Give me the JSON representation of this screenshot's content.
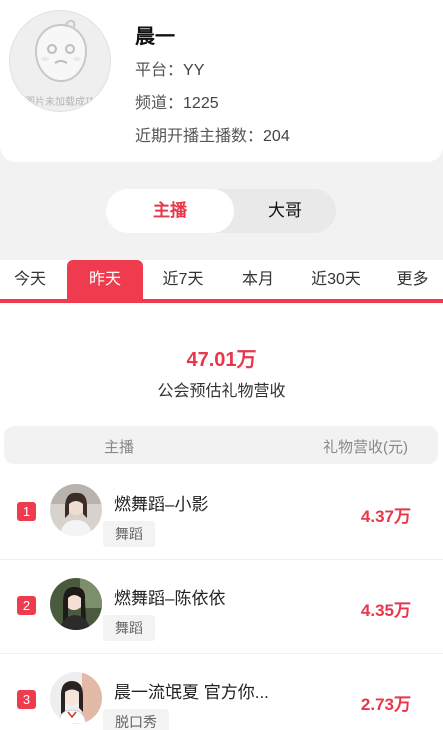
{
  "guild": {
    "avatar_fail_text": "图片未加载成功",
    "name": "晨一",
    "platform_label": "平台：",
    "platform_value": "YY",
    "channel_label": "频道：",
    "channel_value": "1225",
    "recent_label": "近期开播主播数：",
    "recent_value": "204"
  },
  "segment": {
    "options": [
      "主播",
      "大哥"
    ],
    "selected": "主播"
  },
  "tabs": {
    "items": [
      "今天",
      "昨天",
      "近7天",
      "本月",
      "近30天",
      "更多"
    ],
    "selected": "昨天"
  },
  "summary": {
    "total_value": "47.01万",
    "total_label": "公会预估礼物营收"
  },
  "table": {
    "headers": [
      "主播",
      "礼物营收(元)"
    ],
    "rows": [
      {
        "rank": "1",
        "name": "燃舞蹈–小影",
        "tag": "舞蹈",
        "value": "4.37万"
      },
      {
        "rank": "2",
        "name": "燃舞蹈–陈依依",
        "tag": "舞蹈",
        "value": "4.35万"
      },
      {
        "rank": "3",
        "name": "晨一流氓夏 官方你...",
        "tag": "脱口秀",
        "value": "2.73万"
      }
    ]
  },
  "colors": {
    "accent": "#ee3c4e",
    "accent_text": "#e8374a"
  }
}
